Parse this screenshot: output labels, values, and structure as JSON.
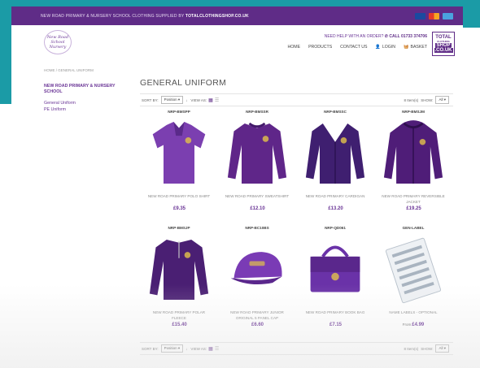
{
  "topbar": {
    "message_prefix": "NEW ROAD PRIMARY & NURSERY SCHOOL CLOTHING SUPPLIED BY ",
    "message_brand": "TOTALCLOTHINGSHOP.CO.UK"
  },
  "header": {
    "logo_text": "New Road School Nursery",
    "help_text": "NEED HELP WITH AN ORDER?",
    "phone": "CALL 01733 374706",
    "nav": [
      "HOME",
      "PRODUCTS",
      "CONTACT US",
      "LOGIN",
      "BASKET"
    ],
    "brand_lines": [
      "TOTAL",
      "CLOTHING",
      "SHOP",
      ".CO.UK"
    ]
  },
  "breadcrumb": "HOME / GENERAL UNIFORM",
  "sidebar": {
    "school": "NEW ROAD PRIMARY & NURSERY SCHOOL",
    "items": [
      "General Uniform",
      "PE Uniform"
    ]
  },
  "main": {
    "title": "GENERAL UNIFORM"
  },
  "toolbar": {
    "sort_label": "SORT BY:",
    "sort_value": "Position",
    "view_label": "VIEW AS:",
    "items_label": "8 Item(s)",
    "show_label": "SHOW:",
    "show_value": "All"
  },
  "products": [
    {
      "code": "NRP-BMSPP",
      "name": "NEW ROAD PRIMARY POLO SHIRT",
      "price": "£9.35",
      "from": "",
      "color": "#7b3fb0",
      "type": "polo"
    },
    {
      "code": "NRP-BMSSR",
      "name": "NEW ROAD PRIMARY SWEATSHIRT",
      "price": "£12.10",
      "from": "",
      "color": "#5f2689",
      "type": "sweat"
    },
    {
      "code": "NRP-BMSSC",
      "name": "NEW ROAD PRIMARY CARDIGAN",
      "price": "£13.20",
      "from": "",
      "color": "#3f1f70",
      "type": "cardigan"
    },
    {
      "code": "NRP-BMSJM",
      "name": "NEW ROAD PRIMARY REVERSIBLE JACKET",
      "price": "£19.25",
      "from": "",
      "color": "#4f1d78",
      "type": "jacket"
    },
    {
      "code": "NRP-BMSJP",
      "name": "NEW ROAD PRIMARY POLAR FLEECE",
      "price": "£15.40",
      "from": "",
      "color": "#4a1f73",
      "type": "fleece"
    },
    {
      "code": "NRP-BC10BS",
      "name": "NEW ROAD PRIMARY JUNIOR ORIGINAL 5 PANEL CAP",
      "price": "£6.60",
      "from": "",
      "color": "#7a3bb5",
      "type": "cap"
    },
    {
      "code": "NRP-QD061",
      "name": "NEW ROAD PRIMARY BOOK BAG",
      "price": "£7.15",
      "from": "",
      "color": "#6a32a8",
      "type": "bag"
    },
    {
      "code": "GEN-LABEL",
      "name": "NAME LABELS - OPTIONAL",
      "price": "£4.99",
      "from": "From",
      "color": "#b9c2cc",
      "type": "labels"
    }
  ]
}
